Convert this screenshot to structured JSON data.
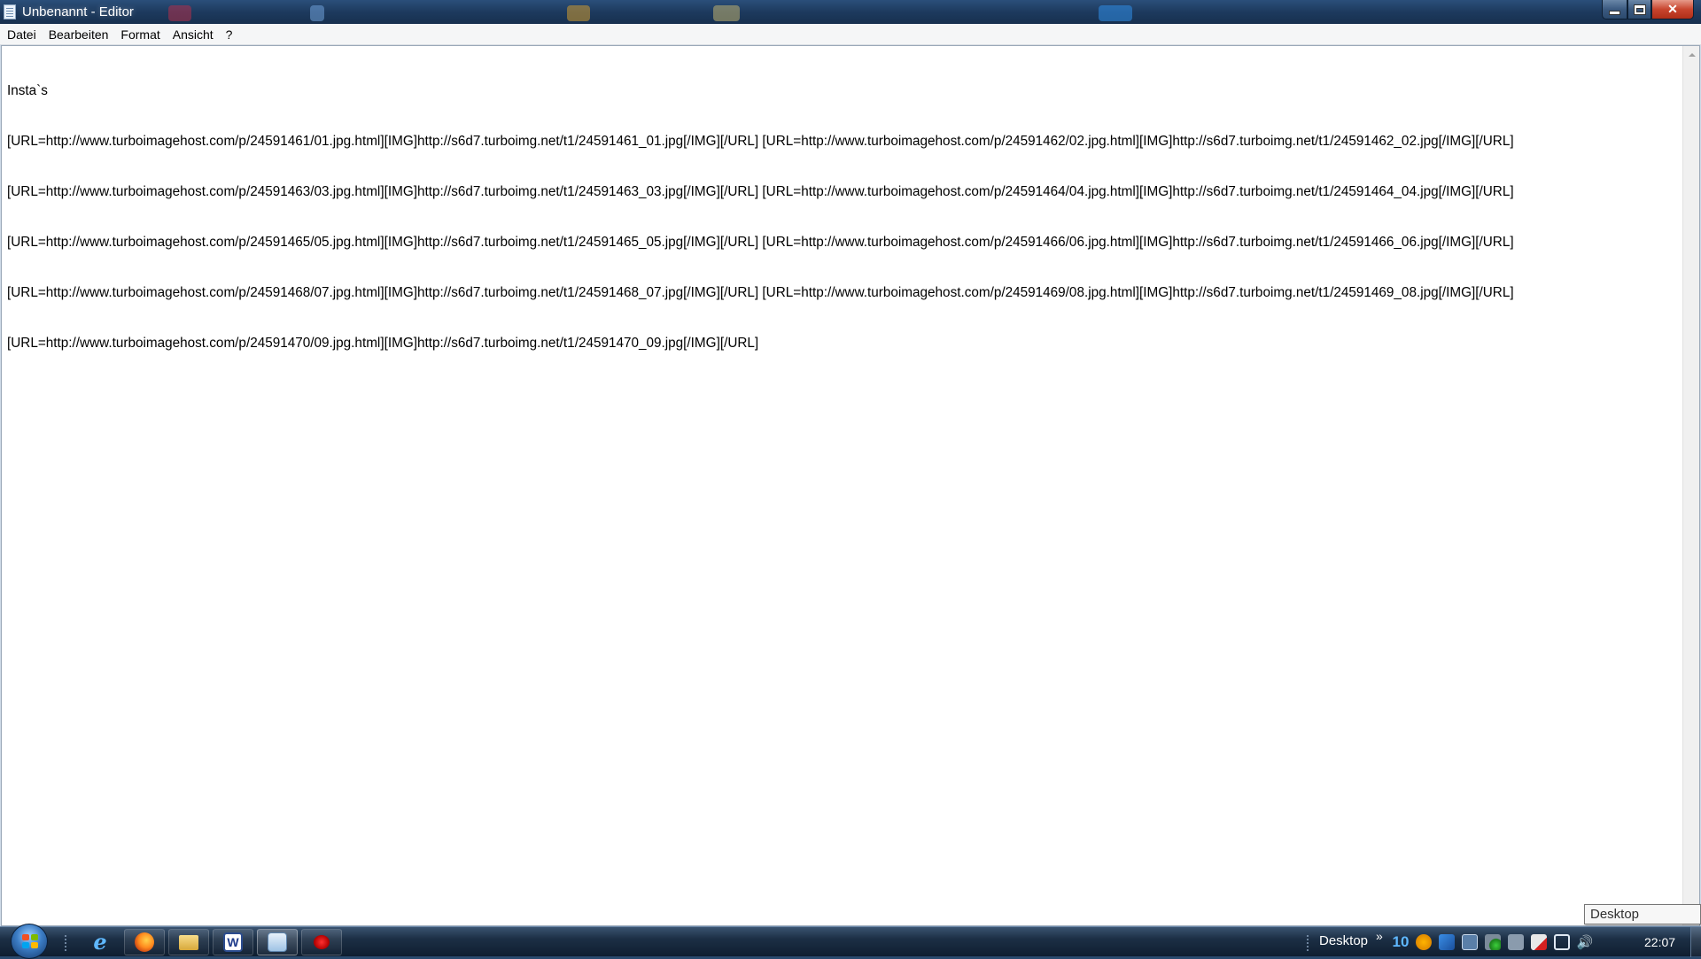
{
  "window": {
    "title": "Unbenannt - Editor",
    "menu": [
      "Datei",
      "Bearbeiten",
      "Format",
      "Ansicht",
      "?"
    ]
  },
  "editor": {
    "lines": [
      "Insta`s",
      "[URL=http://www.turboimagehost.com/p/24591461/01.jpg.html][IMG]http://s6d7.turboimg.net/t1/24591461_01.jpg[/IMG][/URL] [URL=http://www.turboimagehost.com/p/24591462/02.jpg.html][IMG]http://s6d7.turboimg.net/t1/24591462_02.jpg[/IMG][/URL]",
      "[URL=http://www.turboimagehost.com/p/24591463/03.jpg.html][IMG]http://s6d7.turboimg.net/t1/24591463_03.jpg[/IMG][/URL] [URL=http://www.turboimagehost.com/p/24591464/04.jpg.html][IMG]http://s6d7.turboimg.net/t1/24591464_04.jpg[/IMG][/URL]",
      "[URL=http://www.turboimagehost.com/p/24591465/05.jpg.html][IMG]http://s6d7.turboimg.net/t1/24591465_05.jpg[/IMG][/URL] [URL=http://www.turboimagehost.com/p/24591466/06.jpg.html][IMG]http://s6d7.turboimg.net/t1/24591466_06.jpg[/IMG][/URL]",
      "[URL=http://www.turboimagehost.com/p/24591468/07.jpg.html][IMG]http://s6d7.turboimg.net/t1/24591468_07.jpg[/IMG][/URL] [URL=http://www.turboimagehost.com/p/24591469/08.jpg.html][IMG]http://s6d7.turboimg.net/t1/24591469_08.jpg[/IMG][/URL]",
      "[URL=http://www.turboimagehost.com/p/24591470/09.jpg.html][IMG]http://s6d7.turboimg.net/t1/24591470_09.jpg[/IMG][/URL]"
    ]
  },
  "tooltip": "Desktop anzeigen",
  "taskbar": {
    "buttons": [
      {
        "icon": "internet-explorer-icon"
      },
      {
        "icon": "firefox-icon"
      },
      {
        "icon": "file-explorer-icon"
      },
      {
        "icon": "word-icon",
        "glyph": "W"
      },
      {
        "icon": "notepad-icon"
      },
      {
        "icon": "bug-app-icon"
      }
    ],
    "toolbar_label": "Desktop",
    "chevron": "»",
    "tray": [
      {
        "icon": "tray-number-icon",
        "glyph": "10"
      },
      {
        "icon": "tray-avast-icon"
      },
      {
        "icon": "tray-malwarebytes-icon"
      },
      {
        "icon": "tray-app-icon"
      },
      {
        "icon": "tray-network-status-icon"
      },
      {
        "icon": "tray-audio-app-icon"
      },
      {
        "icon": "tray-action-center-icon"
      },
      {
        "icon": "tray-network-icon"
      },
      {
        "icon": "tray-volume-icon"
      }
    ],
    "clock": "22:07"
  },
  "colors": {
    "titlebar": "#1d3a5e",
    "close_button": "#c8452e",
    "editor_bg": "#ffffff",
    "taskbar": "#1c2f45"
  }
}
